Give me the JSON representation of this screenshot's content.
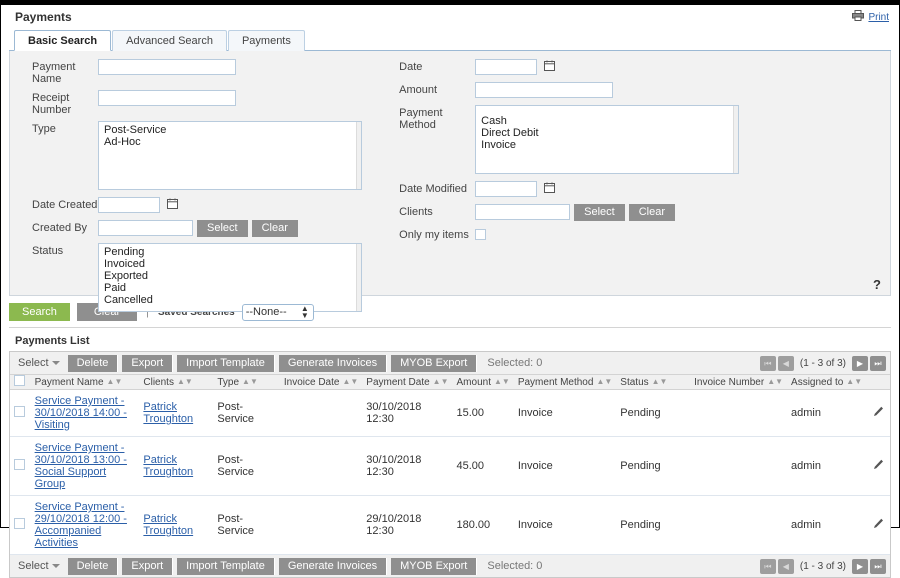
{
  "header": {
    "title": "Payments",
    "print_label": "Print",
    "print_icon": "printer-icon"
  },
  "tabs": [
    {
      "label": "Basic Search",
      "active": true
    },
    {
      "label": "Advanced Search",
      "active": false
    },
    {
      "label": "Payments",
      "active": false,
      "highlighted": true
    }
  ],
  "search_form": {
    "left": {
      "payment_name": {
        "label": "Payment Name",
        "value": "",
        "placeholder": ""
      },
      "receipt_number": {
        "label": "Receipt Number",
        "value": "",
        "placeholder": ""
      },
      "type": {
        "label": "Type",
        "options": [
          "Post-Service",
          "Ad-Hoc"
        ]
      },
      "date_created": {
        "label": "Date Created",
        "value": "",
        "calendar_icon": "calendar-icon"
      },
      "created_by": {
        "label": "Created By",
        "value": "",
        "select_label": "Select",
        "clear_label": "Clear"
      },
      "status": {
        "label": "Status",
        "options": [
          "Pending",
          "Invoiced",
          "Exported",
          "Paid",
          "Cancelled"
        ]
      }
    },
    "right": {
      "date": {
        "label": "Date",
        "value": "",
        "calendar_icon": "calendar-icon"
      },
      "amount": {
        "label": "Amount",
        "value": ""
      },
      "payment_method": {
        "label": "Payment Method",
        "options": [
          "Cash",
          "Direct Debit",
          "Invoice"
        ]
      },
      "date_modified": {
        "label": "Date Modified",
        "value": "",
        "calendar_icon": "calendar-icon"
      },
      "clients": {
        "label": "Clients",
        "value": "",
        "select_label": "Select",
        "clear_label": "Clear"
      },
      "only_my_items": {
        "label": "Only my items",
        "checked": false
      }
    },
    "help_icon": "?"
  },
  "action_bar": {
    "search_label": "Search",
    "clear_label": "Clear",
    "divider": "|",
    "saved_searches_label": "Saved Searches",
    "saved_searches_value": "--None--"
  },
  "list": {
    "title": "Payments List",
    "toolbar": {
      "select_label": "Select",
      "buttons": [
        "Delete",
        "Export",
        "Import Template",
        "Generate Invoices",
        "MYOB Export"
      ],
      "selected_text": "Selected: 0"
    },
    "pager": {
      "first_label": "⏮",
      "prev_label": "◀",
      "range_text": "(1 - 3 of 3)",
      "next_label": "▶",
      "last_label": "⏭"
    },
    "columns": [
      "Payment Name",
      "Clients",
      "Type",
      "Invoice Date",
      "Payment Date",
      "Amount",
      "Payment Method",
      "Status",
      "Invoice Number",
      "Assigned to"
    ],
    "rows": [
      {
        "checked": false,
        "payment_name": "Service Payment - 30/10/2018 14:00 - Visiting",
        "client": "Patrick Troughton",
        "type": "Post-Service",
        "invoice_date": "",
        "payment_date": "30/10/2018 12:30",
        "amount": "15.00",
        "payment_method": "Invoice",
        "status": "Pending",
        "invoice_number": "",
        "assigned_to": "admin",
        "edit_icon": "pencil-icon"
      },
      {
        "checked": false,
        "payment_name": "Service Payment - 30/10/2018 13:00 - Social Support Group",
        "client": "Patrick Troughton",
        "type": "Post-Service",
        "invoice_date": "",
        "payment_date": "30/10/2018 12:30",
        "amount": "45.00",
        "payment_method": "Invoice",
        "status": "Pending",
        "invoice_number": "",
        "assigned_to": "admin",
        "edit_icon": "pencil-icon"
      },
      {
        "checked": false,
        "payment_name": "Service Payment - 29/10/2018 12:00 - Accompanied Activities",
        "client": "Patrick Troughton",
        "type": "Post-Service",
        "invoice_date": "",
        "payment_date": "29/10/2018 12:30",
        "amount": "180.00",
        "payment_method": "Invoice",
        "status": "Pending",
        "invoice_number": "",
        "assigned_to": "admin",
        "edit_icon": "pencil-icon"
      }
    ]
  },
  "colors": {
    "accent_green": "#8cb94f",
    "button_gray": "#8f8f8f",
    "link_blue": "#2b5fa8",
    "panel_bg": "#f2f2f2"
  }
}
